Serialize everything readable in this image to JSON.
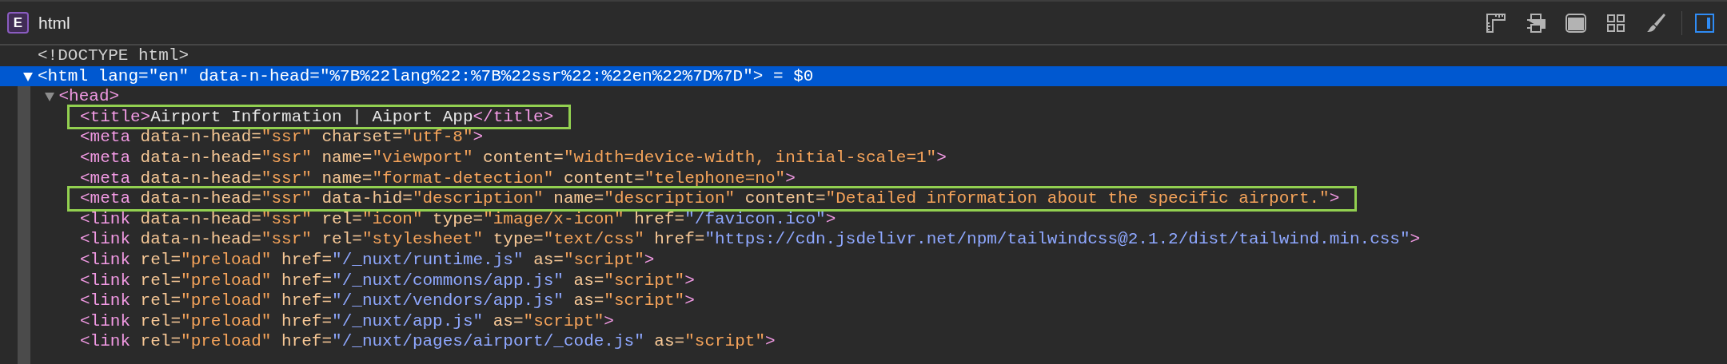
{
  "header": {
    "badge": "E",
    "title": "html"
  },
  "toolbar": [
    {
      "kind": "ruler",
      "selected": false
    },
    {
      "kind": "printer",
      "selected": false
    },
    {
      "kind": "window",
      "selected": false
    },
    {
      "kind": "grid",
      "selected": false
    },
    {
      "kind": "brush",
      "selected": false
    },
    {
      "kind": "sidebar",
      "selected": true
    }
  ],
  "tree": [
    {
      "selected": false,
      "highlighted": false,
      "tokens": [
        {
          "kind": "doctype",
          "text": "<!DOCTYPE html>"
        }
      ]
    },
    {
      "selected": true,
      "highlighted": false,
      "expanded": true,
      "tokens": [
        {
          "kind": "tag",
          "text": "<html"
        },
        {
          "kind": "attr",
          "text": " lang="
        },
        {
          "kind": "value",
          "text": "\"en\""
        },
        {
          "kind": "attr",
          "text": " data-n-head="
        },
        {
          "kind": "value",
          "text": "\"%7B%22lang%22:%7B%22ssr%22:%22en%22%7D%7D\""
        },
        {
          "kind": "tag",
          "text": ">"
        },
        {
          "kind": "ref",
          "text": " = $0"
        }
      ],
      "children": [
        {
          "selected": false,
          "highlighted": false,
          "expanded": true,
          "tokens": [
            {
              "kind": "tag",
              "text": "<head>"
            }
          ],
          "children": [
            {
              "selected": false,
              "highlighted": true,
              "tokens": [
                {
                  "kind": "tag",
                  "text": "<title>"
                },
                {
                  "kind": "text",
                  "text": "Airport Information | Aiport App"
                },
                {
                  "kind": "tag",
                  "text": "</title>"
                }
              ]
            },
            {
              "selected": false,
              "highlighted": false,
              "tokens": [
                {
                  "kind": "tag",
                  "text": "<meta"
                },
                {
                  "kind": "attr",
                  "text": " data-n-head="
                },
                {
                  "kind": "value",
                  "text": "\"ssr\""
                },
                {
                  "kind": "attr",
                  "text": " charset="
                },
                {
                  "kind": "value",
                  "text": "\"utf-8\""
                },
                {
                  "kind": "tag",
                  "text": ">"
                }
              ]
            },
            {
              "selected": false,
              "highlighted": false,
              "tokens": [
                {
                  "kind": "tag",
                  "text": "<meta"
                },
                {
                  "kind": "attr",
                  "text": " data-n-head="
                },
                {
                  "kind": "value",
                  "text": "\"ssr\""
                },
                {
                  "kind": "attr",
                  "text": " name="
                },
                {
                  "kind": "value",
                  "text": "\"viewport\""
                },
                {
                  "kind": "attr",
                  "text": " content="
                },
                {
                  "kind": "value",
                  "text": "\"width=device-width, initial-scale=1\""
                },
                {
                  "kind": "tag",
                  "text": ">"
                }
              ]
            },
            {
              "selected": false,
              "highlighted": false,
              "tokens": [
                {
                  "kind": "tag",
                  "text": "<meta"
                },
                {
                  "kind": "attr",
                  "text": " data-n-head="
                },
                {
                  "kind": "value",
                  "text": "\"ssr\""
                },
                {
                  "kind": "attr",
                  "text": " name="
                },
                {
                  "kind": "value",
                  "text": "\"format-detection\""
                },
                {
                  "kind": "attr",
                  "text": " content="
                },
                {
                  "kind": "value",
                  "text": "\"telephone=no\""
                },
                {
                  "kind": "tag",
                  "text": ">"
                }
              ]
            },
            {
              "selected": false,
              "highlighted": true,
              "tokens": [
                {
                  "kind": "tag",
                  "text": "<meta"
                },
                {
                  "kind": "attr",
                  "text": " data-n-head="
                },
                {
                  "kind": "value",
                  "text": "\"ssr\""
                },
                {
                  "kind": "attr",
                  "text": " data-hid="
                },
                {
                  "kind": "value",
                  "text": "\"description\""
                },
                {
                  "kind": "attr",
                  "text": " name="
                },
                {
                  "kind": "value",
                  "text": "\"description\""
                },
                {
                  "kind": "attr",
                  "text": " content="
                },
                {
                  "kind": "value",
                  "text": "\"Detailed information about the specific airport.\""
                },
                {
                  "kind": "tag",
                  "text": ">"
                }
              ]
            },
            {
              "selected": false,
              "highlighted": false,
              "tokens": [
                {
                  "kind": "tag",
                  "text": "<link"
                },
                {
                  "kind": "attr",
                  "text": " data-n-head="
                },
                {
                  "kind": "value",
                  "text": "\"ssr\""
                },
                {
                  "kind": "attr",
                  "text": " rel="
                },
                {
                  "kind": "value",
                  "text": "\"icon\""
                },
                {
                  "kind": "attr",
                  "text": " type="
                },
                {
                  "kind": "value",
                  "text": "\"image/x-icon\""
                },
                {
                  "kind": "attr",
                  "text": " href="
                },
                {
                  "kind": "link",
                  "text": "\"/favicon.ico\""
                },
                {
                  "kind": "tag",
                  "text": ">"
                }
              ]
            },
            {
              "selected": false,
              "highlighted": false,
              "tokens": [
                {
                  "kind": "tag",
                  "text": "<link"
                },
                {
                  "kind": "attr",
                  "text": " data-n-head="
                },
                {
                  "kind": "value",
                  "text": "\"ssr\""
                },
                {
                  "kind": "attr",
                  "text": " rel="
                },
                {
                  "kind": "value",
                  "text": "\"stylesheet\""
                },
                {
                  "kind": "attr",
                  "text": " type="
                },
                {
                  "kind": "value",
                  "text": "\"text/css\""
                },
                {
                  "kind": "attr",
                  "text": " href="
                },
                {
                  "kind": "link",
                  "text": "\"https://cdn.jsdelivr.net/npm/tailwindcss@2.1.2/dist/tailwind.min.css\""
                },
                {
                  "kind": "tag",
                  "text": ">"
                }
              ]
            },
            {
              "selected": false,
              "highlighted": false,
              "tokens": [
                {
                  "kind": "tag",
                  "text": "<link"
                },
                {
                  "kind": "attr",
                  "text": " rel="
                },
                {
                  "kind": "value",
                  "text": "\"preload\""
                },
                {
                  "kind": "attr",
                  "text": " href="
                },
                {
                  "kind": "link",
                  "text": "\"/_nuxt/runtime.js\""
                },
                {
                  "kind": "attr",
                  "text": " as="
                },
                {
                  "kind": "value",
                  "text": "\"script\""
                },
                {
                  "kind": "tag",
                  "text": ">"
                }
              ]
            },
            {
              "selected": false,
              "highlighted": false,
              "tokens": [
                {
                  "kind": "tag",
                  "text": "<link"
                },
                {
                  "kind": "attr",
                  "text": " rel="
                },
                {
                  "kind": "value",
                  "text": "\"preload\""
                },
                {
                  "kind": "attr",
                  "text": " href="
                },
                {
                  "kind": "link",
                  "text": "\"/_nuxt/commons/app.js\""
                },
                {
                  "kind": "attr",
                  "text": " as="
                },
                {
                  "kind": "value",
                  "text": "\"script\""
                },
                {
                  "kind": "tag",
                  "text": ">"
                }
              ]
            },
            {
              "selected": false,
              "highlighted": false,
              "tokens": [
                {
                  "kind": "tag",
                  "text": "<link"
                },
                {
                  "kind": "attr",
                  "text": " rel="
                },
                {
                  "kind": "value",
                  "text": "\"preload\""
                },
                {
                  "kind": "attr",
                  "text": " href="
                },
                {
                  "kind": "link",
                  "text": "\"/_nuxt/vendors/app.js\""
                },
                {
                  "kind": "attr",
                  "text": " as="
                },
                {
                  "kind": "value",
                  "text": "\"script\""
                },
                {
                  "kind": "tag",
                  "text": ">"
                }
              ]
            },
            {
              "selected": false,
              "highlighted": false,
              "tokens": [
                {
                  "kind": "tag",
                  "text": "<link"
                },
                {
                  "kind": "attr",
                  "text": " rel="
                },
                {
                  "kind": "value",
                  "text": "\"preload\""
                },
                {
                  "kind": "attr",
                  "text": " href="
                },
                {
                  "kind": "link",
                  "text": "\"/_nuxt/app.js\""
                },
                {
                  "kind": "attr",
                  "text": " as="
                },
                {
                  "kind": "value",
                  "text": "\"script\""
                },
                {
                  "kind": "tag",
                  "text": ">"
                }
              ]
            },
            {
              "selected": false,
              "highlighted": false,
              "tokens": [
                {
                  "kind": "tag",
                  "text": "<link"
                },
                {
                  "kind": "attr",
                  "text": " rel="
                },
                {
                  "kind": "value",
                  "text": "\"preload\""
                },
                {
                  "kind": "attr",
                  "text": " href="
                },
                {
                  "kind": "link",
                  "text": "\"/_nuxt/pages/airport/_code.js\""
                },
                {
                  "kind": "attr",
                  "text": " as="
                },
                {
                  "kind": "value",
                  "text": "\"script\""
                },
                {
                  "kind": "tag",
                  "text": ">"
                }
              ]
            }
          ]
        }
      ]
    }
  ]
}
